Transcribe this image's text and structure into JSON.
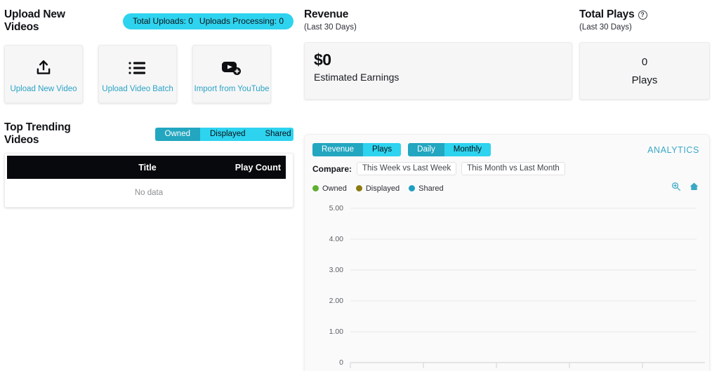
{
  "upload": {
    "title": "Upload New Videos",
    "badge": {
      "total_uploads": "Total Uploads: 0",
      "uploads_processing": "Uploads Processing: 0"
    },
    "cards": [
      {
        "label": "Upload New Video",
        "icon": "upload-icon"
      },
      {
        "label": "Upload Video Batch",
        "icon": "list-icon"
      },
      {
        "label": "Import from YouTube",
        "icon": "youtube-plus-icon"
      }
    ]
  },
  "trending": {
    "title": "Top Trending Videos",
    "tabs": [
      {
        "label": "Owned",
        "active": true
      },
      {
        "label": "Displayed",
        "active": false
      },
      {
        "label": "Shared",
        "active": false
      }
    ],
    "columns": [
      "Title",
      "Play Count"
    ],
    "empty_text": "No data"
  },
  "revenue": {
    "title": "Revenue",
    "period": "(Last 30 Days)",
    "amount": "$0",
    "caption": "Estimated Earnings"
  },
  "total_plays": {
    "title": "Total Plays",
    "help_icon": "question-mark-icon",
    "help_glyph": "?",
    "period": "(Last 30 Days)",
    "value": "0",
    "caption": "Plays"
  },
  "analytics": {
    "panel_title": "ANALYTICS",
    "metric_tabs": [
      {
        "label": "Revenue",
        "active": true
      },
      {
        "label": "Plays",
        "active": false
      }
    ],
    "range_tabs": [
      {
        "label": "Daily",
        "active": true
      },
      {
        "label": "Monthly",
        "active": false
      }
    ],
    "compare_label": "Compare:",
    "compare_options": [
      "This Week vs Last Week",
      "This Month vs Last Month"
    ],
    "legend": [
      {
        "label": "Owned",
        "color": "#5cb030"
      },
      {
        "label": "Displayed",
        "color": "#8c7a10"
      },
      {
        "label": "Shared",
        "color": "#1f9ec0"
      }
    ],
    "tools": [
      {
        "name": "zoom-in-icon"
      },
      {
        "name": "home-icon"
      }
    ]
  },
  "chart_data": {
    "type": "line",
    "title": "",
    "xlabel": "",
    "ylabel": "",
    "ylim": [
      0,
      5
    ],
    "yticks": [
      "0",
      "1.00",
      "2.00",
      "3.00",
      "4.00",
      "5.00"
    ],
    "ytick_values": [
      0,
      1,
      2,
      3,
      4,
      5
    ],
    "x": [],
    "xticks": [],
    "grid": true,
    "legend_position": "top-left",
    "series": [
      {
        "name": "Owned",
        "color": "#5cb030",
        "values": []
      },
      {
        "name": "Displayed",
        "color": "#8c7a10",
        "values": []
      },
      {
        "name": "Shared",
        "color": "#1f9ec0",
        "values": []
      }
    ]
  },
  "theme": {
    "accent_cyan": "#2ed3ef",
    "accent_teal": "#23a6c0",
    "link_blue": "#2aa3c4",
    "header_black": "#07090c"
  }
}
